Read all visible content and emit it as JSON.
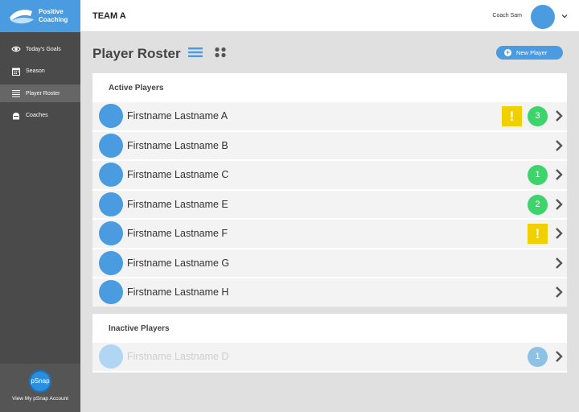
{
  "brand": {
    "line1": "Positive",
    "line2": "Coaching"
  },
  "sidebar": {
    "items": [
      {
        "label": "Today's Goals",
        "icon": "eye-icon"
      },
      {
        "label": "Season",
        "icon": "calendar-icon"
      },
      {
        "label": "Player Roster",
        "icon": "list-icon"
      },
      {
        "label": "Coaches",
        "icon": "whistle-icon"
      }
    ],
    "footer": {
      "badge": "pSnap",
      "label": "View My pSnap Account"
    }
  },
  "topbar": {
    "team": "TEAM A",
    "coach": "Coach Sam"
  },
  "page": {
    "title": "Player Roster",
    "new_button": "New Player"
  },
  "active": {
    "title": "Active Players",
    "players": [
      {
        "name": "Firstname Lastname A",
        "warn": "!",
        "count": "3"
      },
      {
        "name": "Firstname Lastname B"
      },
      {
        "name": "Firstname Lastname C",
        "count": "1"
      },
      {
        "name": "Firstname Lastname E",
        "count": "2"
      },
      {
        "name": "Firstname Lastname F",
        "warn": "!"
      },
      {
        "name": "Firstname Lastname G"
      },
      {
        "name": "Firstname Lastname H"
      }
    ]
  },
  "inactive": {
    "title": "Inactive Players",
    "players": [
      {
        "name": "Firstname Lastname D",
        "count": "1"
      }
    ]
  },
  "colors": {
    "brand": "#4a9be0",
    "sidebar": "#4a4a4a",
    "badge_green": "#3dd46c",
    "warning": "#f0d000"
  }
}
